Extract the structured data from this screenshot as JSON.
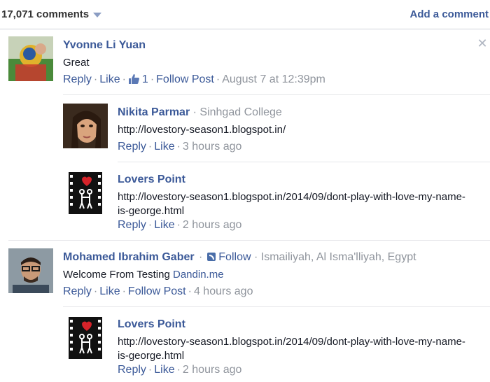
{
  "header": {
    "comment_count": "17,071 comments",
    "add_comment": "Add a comment"
  },
  "comments": [
    {
      "author": "Yvonne Li Yuan",
      "text": "Great",
      "reply": "Reply",
      "like": "Like",
      "like_count": "1",
      "follow": "Follow Post",
      "time": "August 7 at 12:39pm"
    },
    {
      "author": "Nikita Parmar",
      "affiliation": "· Sinhgad College",
      "text": "http://lovestory-season1.blogspot.in/",
      "reply": "Reply",
      "like": "Like",
      "time": "3 hours ago"
    },
    {
      "author": "Lovers Point",
      "text": "http://lovestory-season1.blogspot.in/2014/09/dont-play-with-love-my-name-is-george.html",
      "reply": "Reply",
      "like": "Like",
      "time": "2 hours ago"
    },
    {
      "author": "Mohamed Ibrahim Gaber",
      "follow_label": "Follow",
      "location": "· Ismailiyah, Al Isma'lliyah, Egypt",
      "text_prefix": "Welcome From Testing",
      "text_link": "Dandin.me",
      "reply": "Reply",
      "like": "Like",
      "follow": "Follow Post",
      "time": "4 hours ago"
    },
    {
      "author": "Lovers Point",
      "text": "http://lovestory-season1.blogspot.in/2014/09/dont-play-with-love-my-name-is-george.html",
      "reply": "Reply",
      "like": "Like",
      "time": "2 hours ago"
    }
  ],
  "icons": {
    "close": "close-icon",
    "like_thumb": "thumbs-up-icon",
    "rss": "rss-icon",
    "caret": "caret-down-icon"
  },
  "colors": {
    "link": "#3b5998",
    "meta": "#8f949c",
    "divider": "#e5e6e9"
  }
}
